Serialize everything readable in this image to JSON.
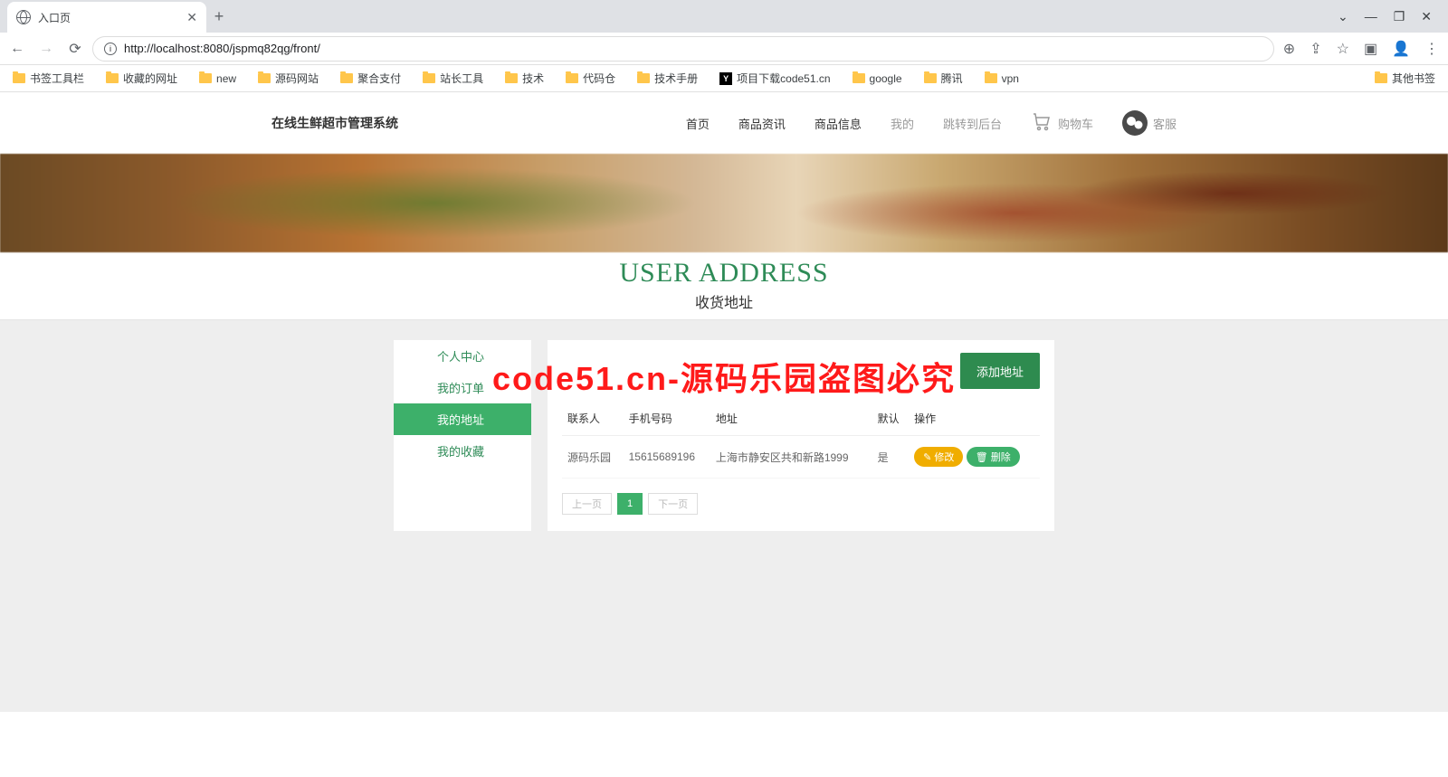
{
  "browser": {
    "tab_title": "入口页",
    "url": "http://localhost:8080/jspmq82qg/front/",
    "win": {
      "min": "—",
      "max": "❐",
      "close": "✕"
    }
  },
  "bookmarks": {
    "items": [
      "书签工具栏",
      "收藏的网址",
      "new",
      "源码网站",
      "聚合支付",
      "站长工具",
      "技术",
      "代码仓",
      "技术手册",
      "项目下载code51.cn",
      "google",
      "腾讯",
      "vpn"
    ],
    "overflow": "其他书签"
  },
  "header": {
    "brand": "在线生鲜超市管理系统",
    "nav": [
      "首页",
      "商品资讯",
      "商品信息",
      "我的",
      "跳转到后台"
    ],
    "cart": "购物车",
    "service": "客服"
  },
  "title": {
    "en": "USER ADDRESS",
    "zh": "收货地址"
  },
  "sidebar": {
    "items": [
      "个人中心",
      "我的订单",
      "我的地址",
      "我的收藏"
    ],
    "active_index": 2
  },
  "content": {
    "add_button": "添加地址",
    "columns": [
      "联系人",
      "手机号码",
      "地址",
      "默认",
      "操作"
    ],
    "rows": [
      {
        "contact": "源码乐园",
        "phone": "15615689196",
        "addr": "上海市静安区共和新路1999",
        "default": "是"
      }
    ],
    "actions": {
      "edit": "修改",
      "delete": "删除"
    },
    "pager": {
      "prev": "上一页",
      "current": "1",
      "next": "下一页"
    }
  },
  "watermark": "code51.cn-源码乐园盗图必究"
}
